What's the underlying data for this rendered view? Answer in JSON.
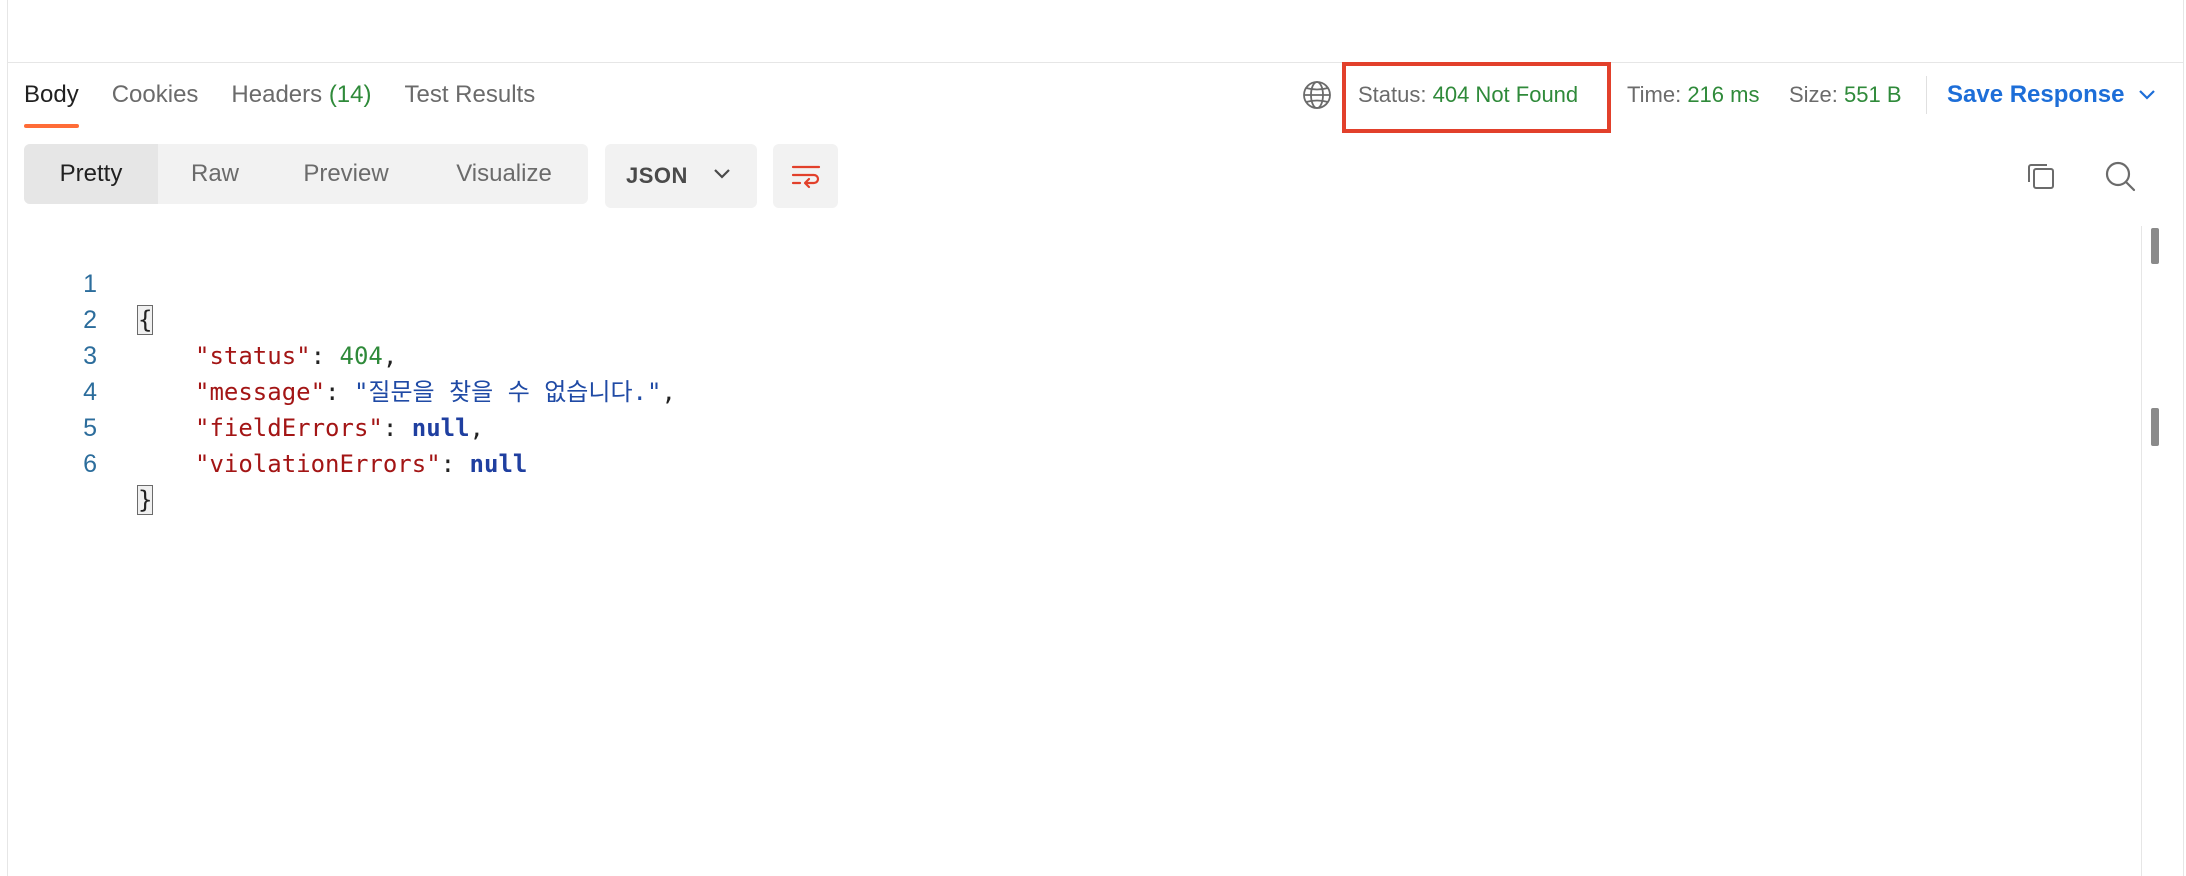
{
  "tabs": [
    {
      "label": "Body",
      "count": ""
    },
    {
      "label": "Cookies",
      "count": ""
    },
    {
      "label": "Headers",
      "count": "(14)"
    },
    {
      "label": "Test Results",
      "count": ""
    }
  ],
  "status": {
    "label": "Status:",
    "value": "404 Not Found"
  },
  "time": {
    "label": "Time:",
    "value": "216 ms"
  },
  "size": {
    "label": "Size:",
    "value": "551 B"
  },
  "save_response_label": "Save Response",
  "view_modes": [
    "Pretty",
    "Raw",
    "Preview",
    "Visualize"
  ],
  "format_select": {
    "value": "JSON"
  },
  "code": {
    "line_numbers": [
      "1",
      "2",
      "3",
      "4",
      "5",
      "6"
    ],
    "open_brace": "{",
    "close_brace": "}",
    "entries": [
      {
        "key": "\"status\"",
        "value": "404",
        "type": "num",
        "trail": ","
      },
      {
        "key": "\"message\"",
        "value": "\"질문을 찾을 수 없습니다.\"",
        "type": "str",
        "trail": ","
      },
      {
        "key": "\"fieldErrors\"",
        "value": "null",
        "type": "kw",
        "trail": ","
      },
      {
        "key": "\"violationErrors\"",
        "value": "null",
        "type": "kw",
        "trail": ""
      }
    ]
  },
  "colors": {
    "accent": "#ff6c37",
    "status_ok": "#2f8a3a",
    "highlight_box": "#e2402b",
    "link_blue": "#1d6ed8"
  },
  "icons": {
    "globe": "globe-icon",
    "chevron": "chevron-down-icon",
    "wrap": "wrap-lines-icon",
    "copy": "copy-icon",
    "search": "search-icon"
  }
}
